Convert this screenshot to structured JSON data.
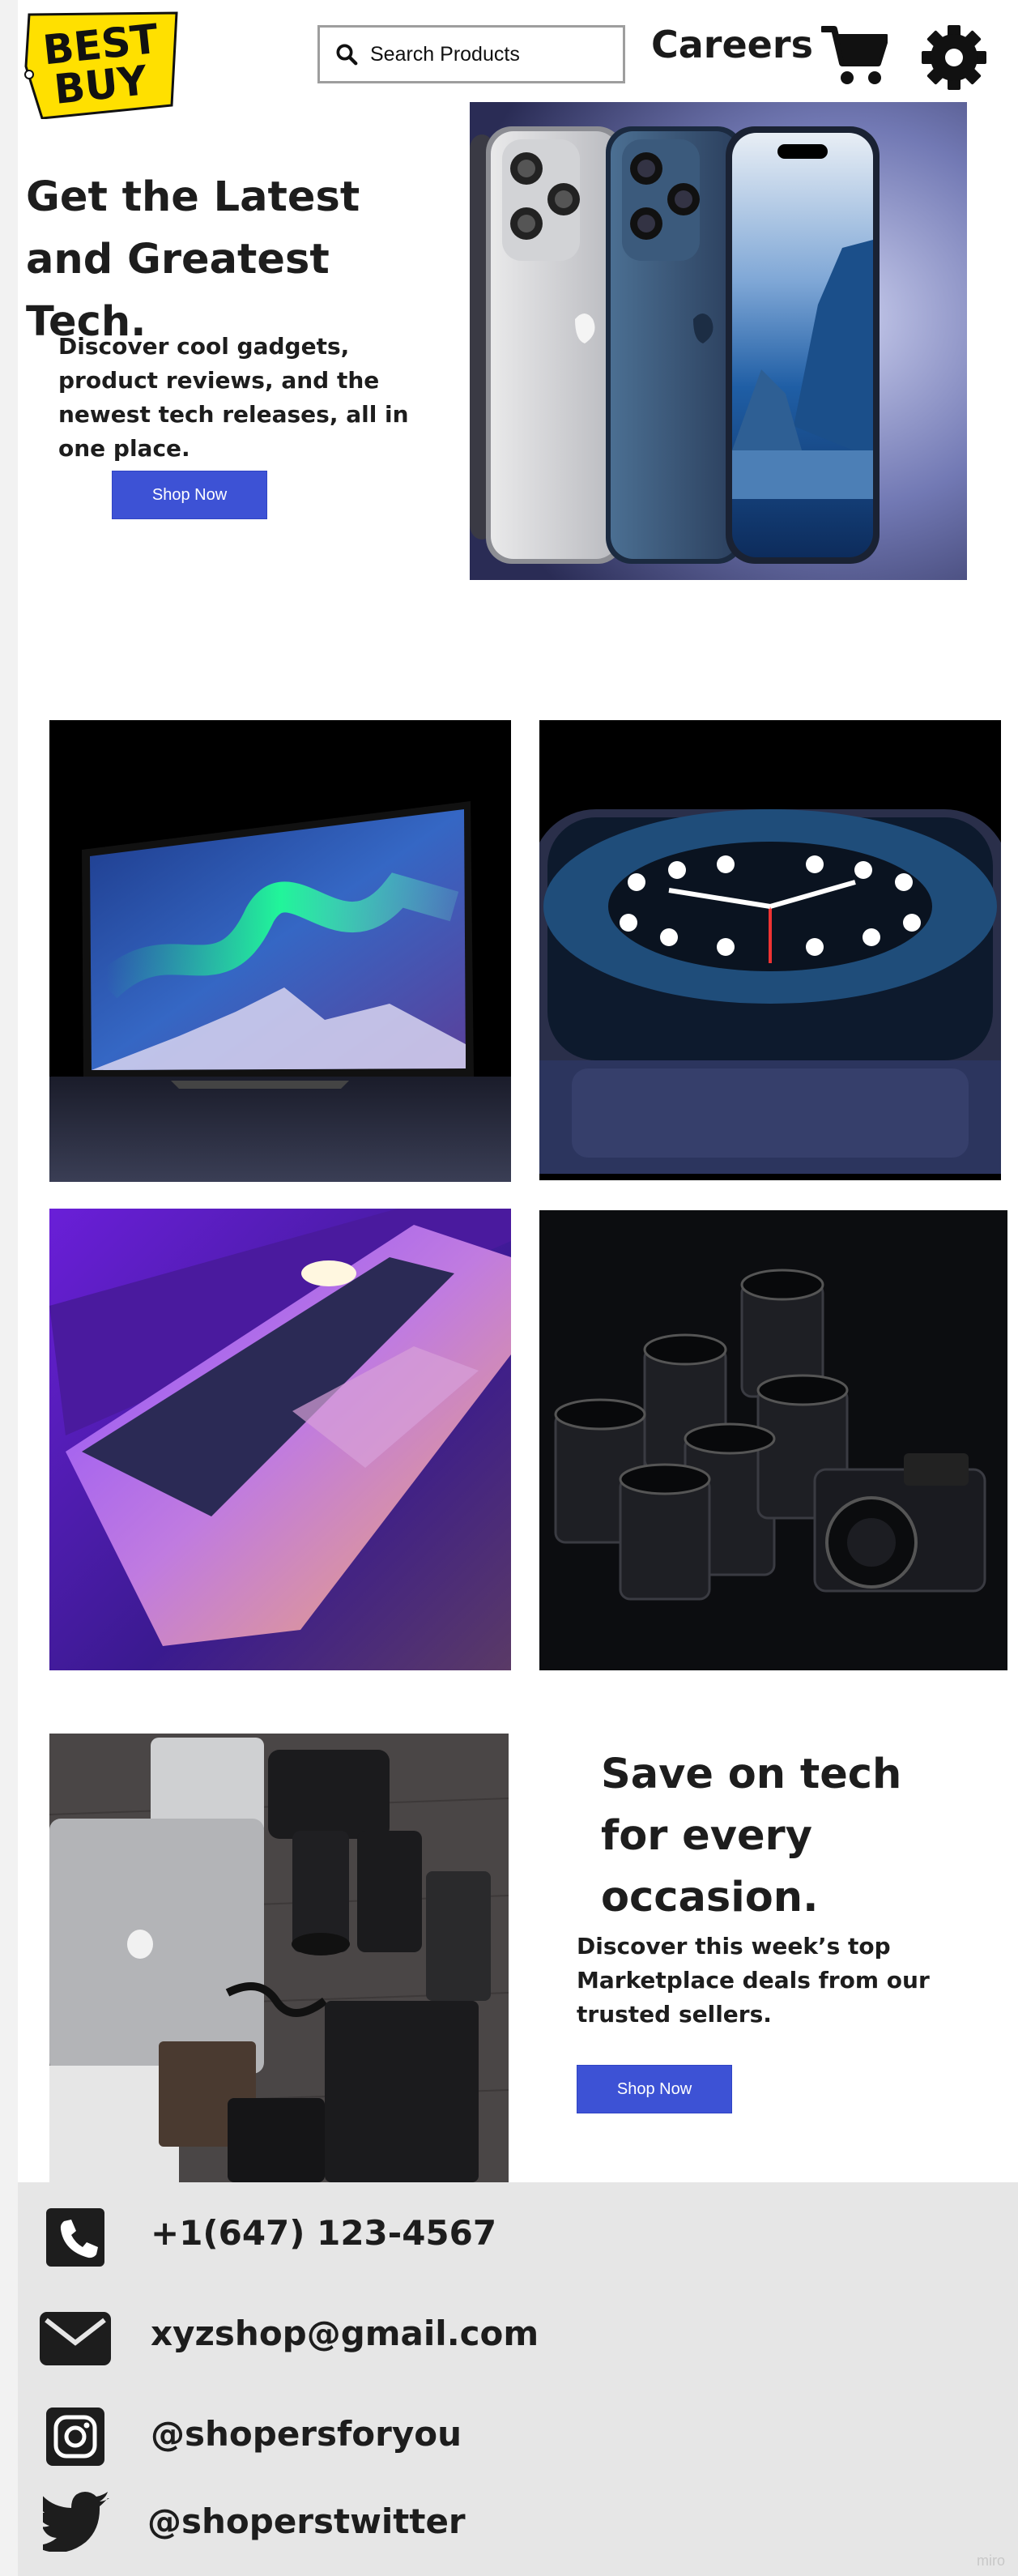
{
  "header": {
    "logo_text": "BEST BUY",
    "search_placeholder": "Search Products",
    "careers_label": "Careers",
    "icons": [
      "search-icon",
      "cart-icon",
      "gear-icon"
    ]
  },
  "hero": {
    "title": "Get the Latest and Greatest Tech.",
    "description": "Discover cool gadgets, product reviews, and the newest tech releases, all in one place.",
    "button_label": "Shop Now"
  },
  "gallery": {
    "items": [
      "tv",
      "smartwatch",
      "laptop",
      "camera-lenses"
    ]
  },
  "promo": {
    "title": "Save on tech for every occasion.",
    "description": "Discover this week’s top Marketplace deals from our trusted sellers.",
    "button_label": "Shop Now"
  },
  "footer": {
    "phone": "+1(647) 123-4567",
    "email": "xyzshop@gmail.com",
    "instagram": "@shopersforyou",
    "twitter": "@shoperstwitter"
  },
  "watermark": "miro",
  "colors": {
    "accent": "#3d52d5",
    "logo_yellow": "#ffe000",
    "footer_bg": "#e6e6e6",
    "text": "#1d1d1d"
  }
}
